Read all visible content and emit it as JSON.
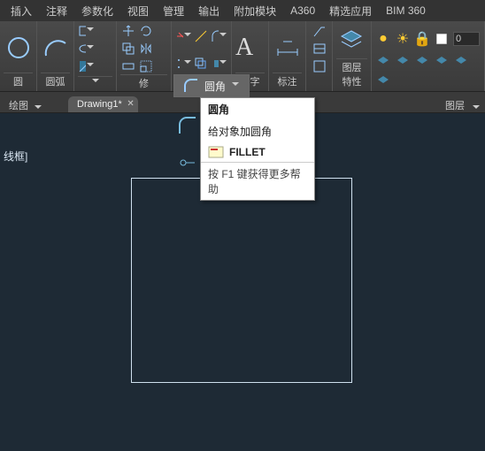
{
  "menubar": {
    "items": [
      "插入",
      "注释",
      "参数化",
      "视图",
      "管理",
      "输出",
      "附加模块",
      "A360",
      "精选应用",
      "BIM 360"
    ]
  },
  "ribbon": {
    "panels": [
      {
        "label": "圆"
      },
      {
        "label": "圆弧"
      },
      {
        "label": ""
      },
      {
        "label": "修"
      },
      {
        "label": "文字"
      },
      {
        "label": "标注"
      },
      {
        "label": ""
      },
      {
        "label": "图层\n特性"
      },
      {
        "label": ""
      }
    ]
  },
  "layer_value": "0",
  "tabbar": {
    "left": "绘图",
    "tab": "Drawing1*",
    "right": "图层"
  },
  "status": "线框]",
  "tooltip": {
    "main": "圆角"
  },
  "popup": {
    "title": "圆角",
    "desc": "给对象加圆角",
    "cmd": "FILLET",
    "hint": "按 F1 键获得更多帮助"
  }
}
